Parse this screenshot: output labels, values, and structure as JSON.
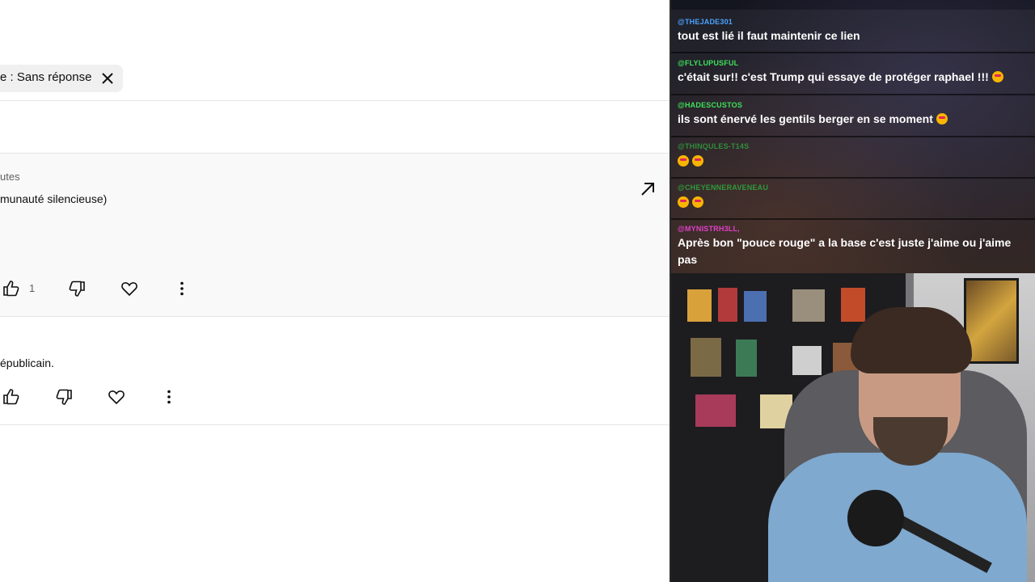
{
  "filter_chip": {
    "label": "e : Sans réponse"
  },
  "comments": [
    {
      "meta": "utes",
      "text": "munauté silencieuse)",
      "likes": "1"
    },
    {
      "text": "épublicain."
    }
  ],
  "chat": {
    "messages": [
      {
        "user": "@THEJADE301",
        "user_color": "#4aa3ff",
        "text": "tout est lié il faut maintenir ce lien"
      },
      {
        "user": "@FLYLUPUSFUL",
        "user_color": "#3ee05a",
        "text": "c'était sur!! c'est Trump qui essaye de protéger raphael !!!",
        "emoji": [
          "rofl-emoji"
        ]
      },
      {
        "user": "@HADESCUSTOS",
        "user_color": "#3ee05a",
        "text": "ils sont énervé les gentils berger en se moment",
        "emoji": [
          "heart-eyes-emoji"
        ]
      },
      {
        "user": "@THINQULES-T14S",
        "user_color": "#2f8f3a",
        "text": "",
        "emoji": [
          "heart-eyes-emoji",
          "heart-eyes-emoji"
        ]
      },
      {
        "user": "@CHEYENNERAVENEAU",
        "user_color": "#2f9a3a",
        "text": "",
        "emoji": [
          "heart-eyes-emoji",
          "heart-eyes-emoji"
        ]
      },
      {
        "user": "@MYNISTRH3LL,",
        "user_color": "#e040c8",
        "text": "Après bon \"pouce rouge\" a la base c'est juste j'aime ou j'aime pas"
      }
    ]
  },
  "colors": {
    "page_bg": "#ffffff",
    "comment_bg": "#f9f9f9",
    "icon": "#0f0f0f"
  }
}
